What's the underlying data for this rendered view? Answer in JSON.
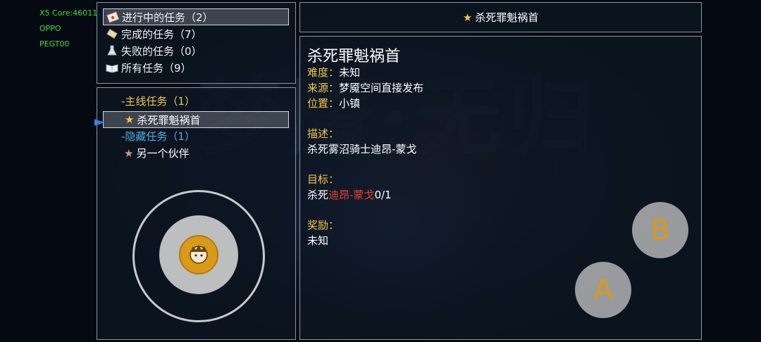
{
  "debug": {
    "lines": [
      "X5 Core:46011",
      "OPPO",
      "PEGT00"
    ]
  },
  "menu": {
    "items": [
      {
        "label": "进行中的任务（2）",
        "icon": "letter-icon"
      },
      {
        "label": "完成的任务（7）",
        "icon": "scroll-icon"
      },
      {
        "label": "失败的任务（0）",
        "icon": "flask-icon"
      },
      {
        "label": "所有任务（9）",
        "icon": "book-icon"
      }
    ]
  },
  "quest_list": {
    "main_category": "-主线任务（1）",
    "main_quest": "杀死罪魁祸首",
    "hidden_category": "-隐藏任务（1）",
    "hidden_quest": "另一个伙伴"
  },
  "header": {
    "title": "杀死罪魁祸首"
  },
  "detail": {
    "title": "杀死罪魁祸首",
    "difficulty_label": "难度：",
    "difficulty": "未知",
    "source_label": "来源：",
    "source": "梦魇空间直接发布",
    "location_label": "位置：",
    "location": "小镇",
    "description_label": "描述：",
    "description": "杀死雾沼骑士迪昂-蒙戈",
    "objective_label": "目标：",
    "objective_prefix": "杀死",
    "objective_target": "迪昂-蒙戈",
    "objective_progress": "0/1",
    "reward_label": "奖励：",
    "reward": "未知"
  },
  "controls": {
    "btn_b": "B",
    "btn_a": "A"
  },
  "colors": {
    "gold": "#f0c64a",
    "blue": "#4cb0e8",
    "red": "#e8402c",
    "debug_green": "#3ee03e"
  }
}
